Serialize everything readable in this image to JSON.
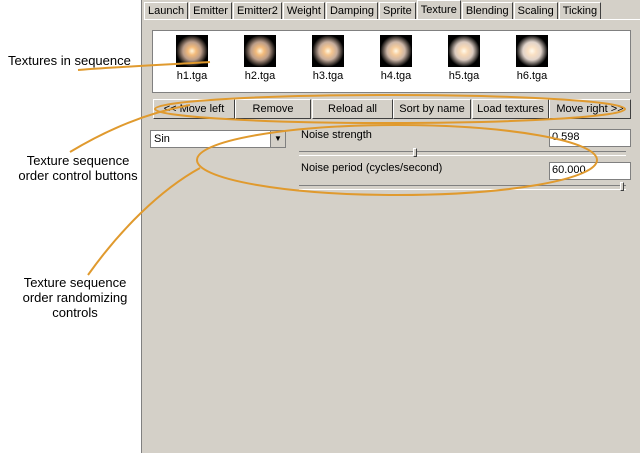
{
  "tabs": [
    "Launch",
    "Emitter",
    "Emitter2",
    "Weight",
    "Damping",
    "Sprite",
    "Texture",
    "Blending",
    "Scaling",
    "Ticking"
  ],
  "active_tab": "Texture",
  "textures": [
    "h1.tga",
    "h2.tga",
    "h3.tga",
    "h4.tga",
    "h5.tga",
    "h6.tga"
  ],
  "buttons": {
    "move_left": "<< Move left",
    "remove": "Remove",
    "reload_all": "Reload all",
    "sort_by_name": "Sort by name",
    "load_textures": "Load textures",
    "move_right": "Move right >>"
  },
  "mode_select": {
    "value": "Sin"
  },
  "noise_strength": {
    "label": "Noise strength",
    "value": "0.598",
    "slider_fraction": 0.598
  },
  "noise_period": {
    "label": "Noise period (cycles/second)",
    "value": "60.000",
    "slider_fraction": 1.0
  },
  "annotations": {
    "textures_in_sequence": "Textures in sequence",
    "order_control_buttons_line1": "Texture sequence",
    "order_control_buttons_line2": "order control buttons",
    "randomizing_line1": "Texture sequence",
    "randomizing_line2": "order randomizing",
    "randomizing_line3": "controls"
  },
  "colors": {
    "annotation_stroke": "#e09a2e",
    "panel": "#d4d0c8"
  }
}
